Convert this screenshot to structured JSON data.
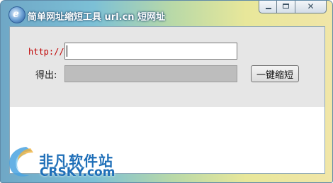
{
  "window": {
    "title": "简单网址缩短工具  url.cn 短网址",
    "close_glyph": "✕"
  },
  "form": {
    "url_label": "http://",
    "url_value": "",
    "result_label": "得出:",
    "result_value": "",
    "shorten_button": "一键缩短"
  },
  "watermark": {
    "name_cn": "非凡软件站",
    "name_en": "CRSKY.com"
  }
}
